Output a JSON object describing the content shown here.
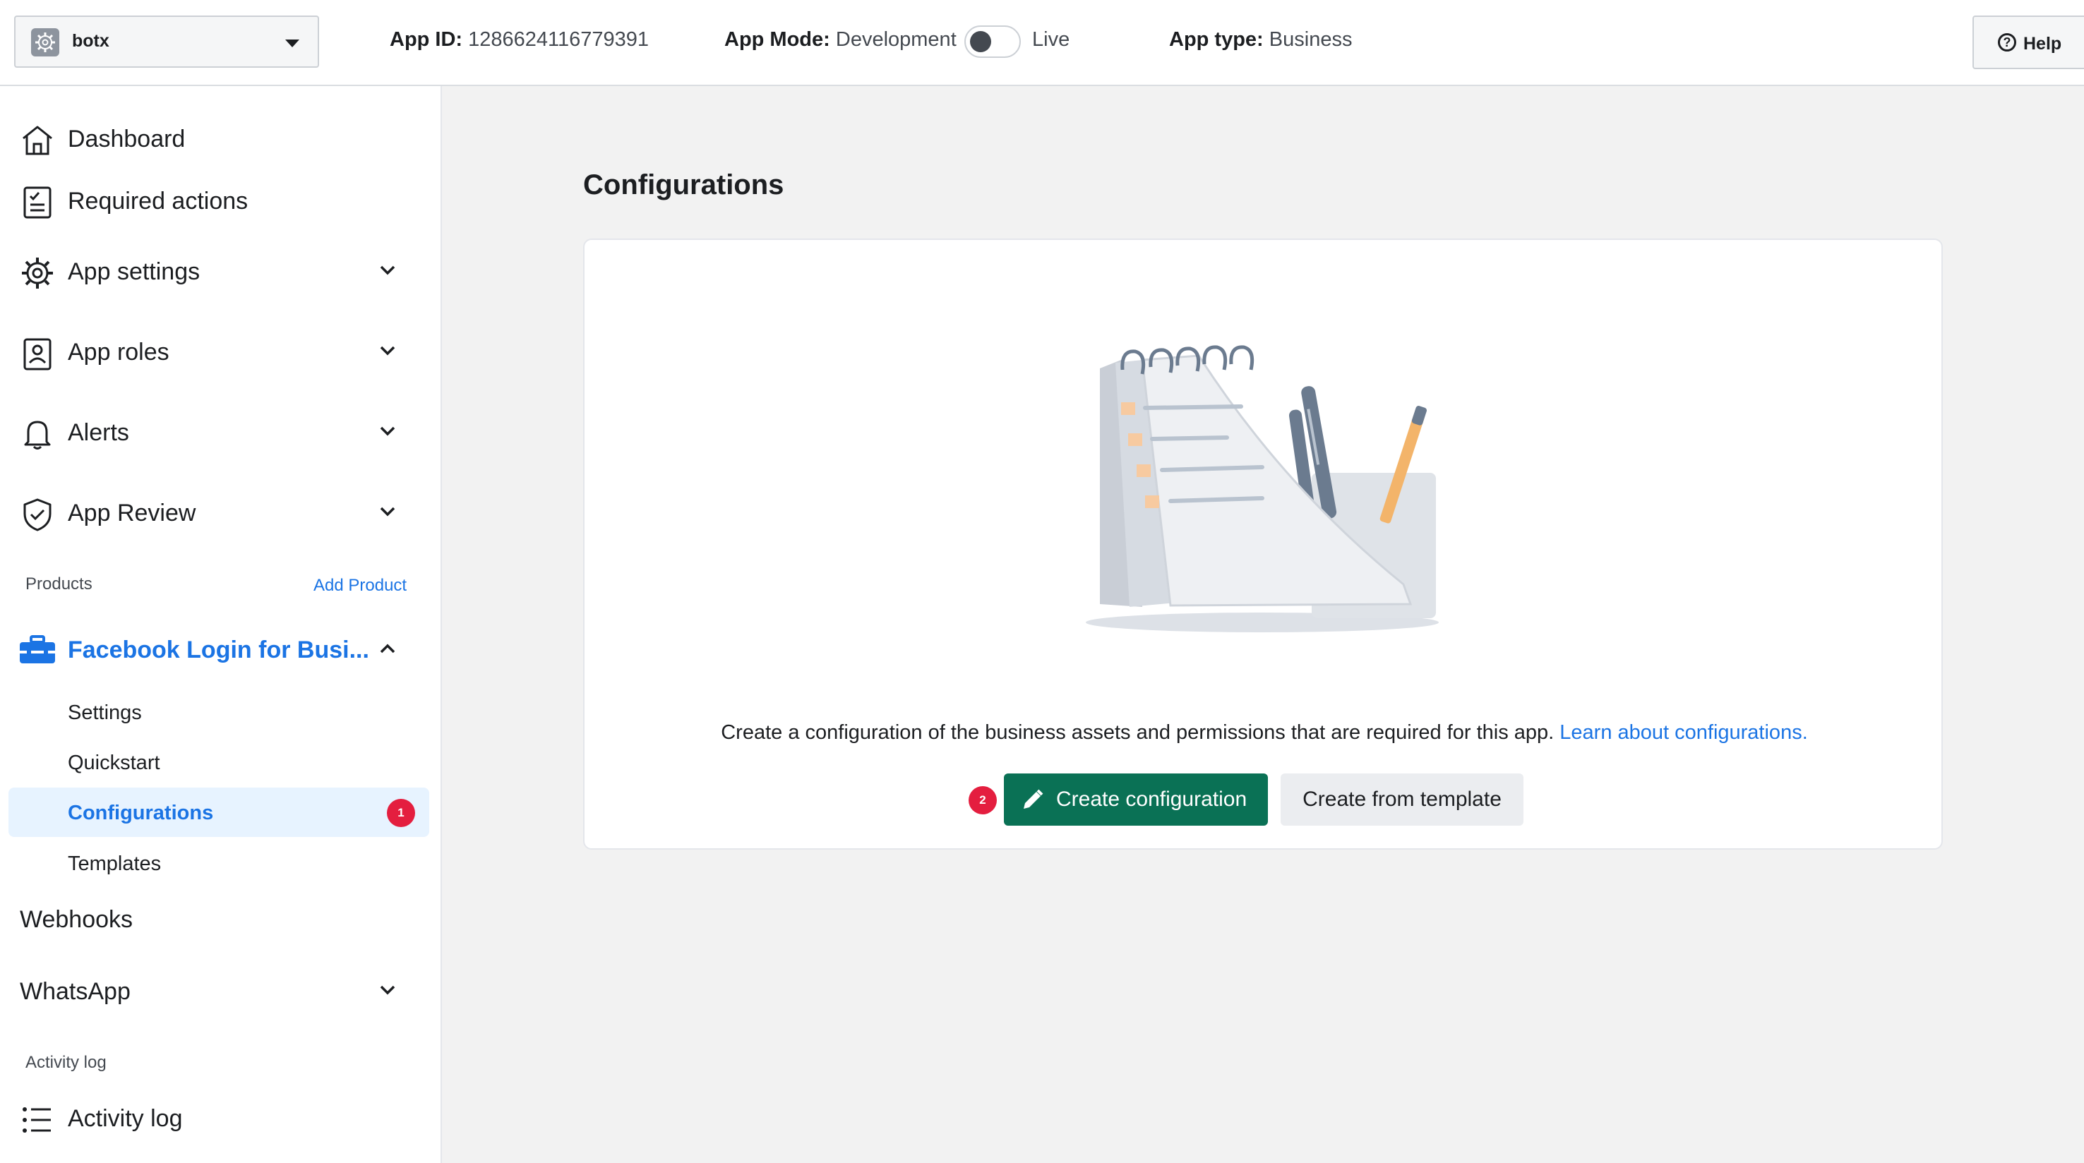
{
  "header": {
    "app_name": "botx",
    "app_id_label": "App ID:",
    "app_id_value": "1286624116779391",
    "app_mode_label": "App Mode:",
    "app_mode_value": "Development",
    "live_label": "Live",
    "app_type_label": "App type:",
    "app_type_value": "Business",
    "help_label": "Help"
  },
  "sidebar": {
    "items": [
      {
        "label": "Dashboard",
        "icon": "home-icon"
      },
      {
        "label": "Required actions",
        "icon": "checklist-icon"
      },
      {
        "label": "App settings",
        "icon": "gear-icon"
      },
      {
        "label": "App roles",
        "icon": "id-badge-icon"
      },
      {
        "label": "Alerts",
        "icon": "bell-icon"
      },
      {
        "label": "App Review",
        "icon": "shield-check-icon"
      }
    ],
    "products_label": "Products",
    "add_product_label": "Add Product",
    "product": {
      "label": "Facebook Login for Busi...",
      "icon": "briefcase-icon"
    },
    "sub_items": [
      {
        "label": "Settings"
      },
      {
        "label": "Quickstart"
      },
      {
        "label": "Configurations",
        "badge": "1"
      },
      {
        "label": "Templates"
      }
    ],
    "webhooks_label": "Webhooks",
    "whatsapp_label": "WhatsApp",
    "activity_section_label": "Activity log",
    "activity_item": {
      "label": "Activity log",
      "icon": "list-icon"
    }
  },
  "main": {
    "title": "Configurations",
    "description": "Create a configuration of the business assets and permissions that are required for this app.",
    "learn_link": "Learn about configurations.",
    "step_badge": "2",
    "create_button": "Create configuration",
    "template_button": "Create from template"
  },
  "colors": {
    "accent": "#1b74e4",
    "primary_button": "#0a7155",
    "badge": "#e41e3f",
    "active_bg": "#e7f3ff"
  }
}
